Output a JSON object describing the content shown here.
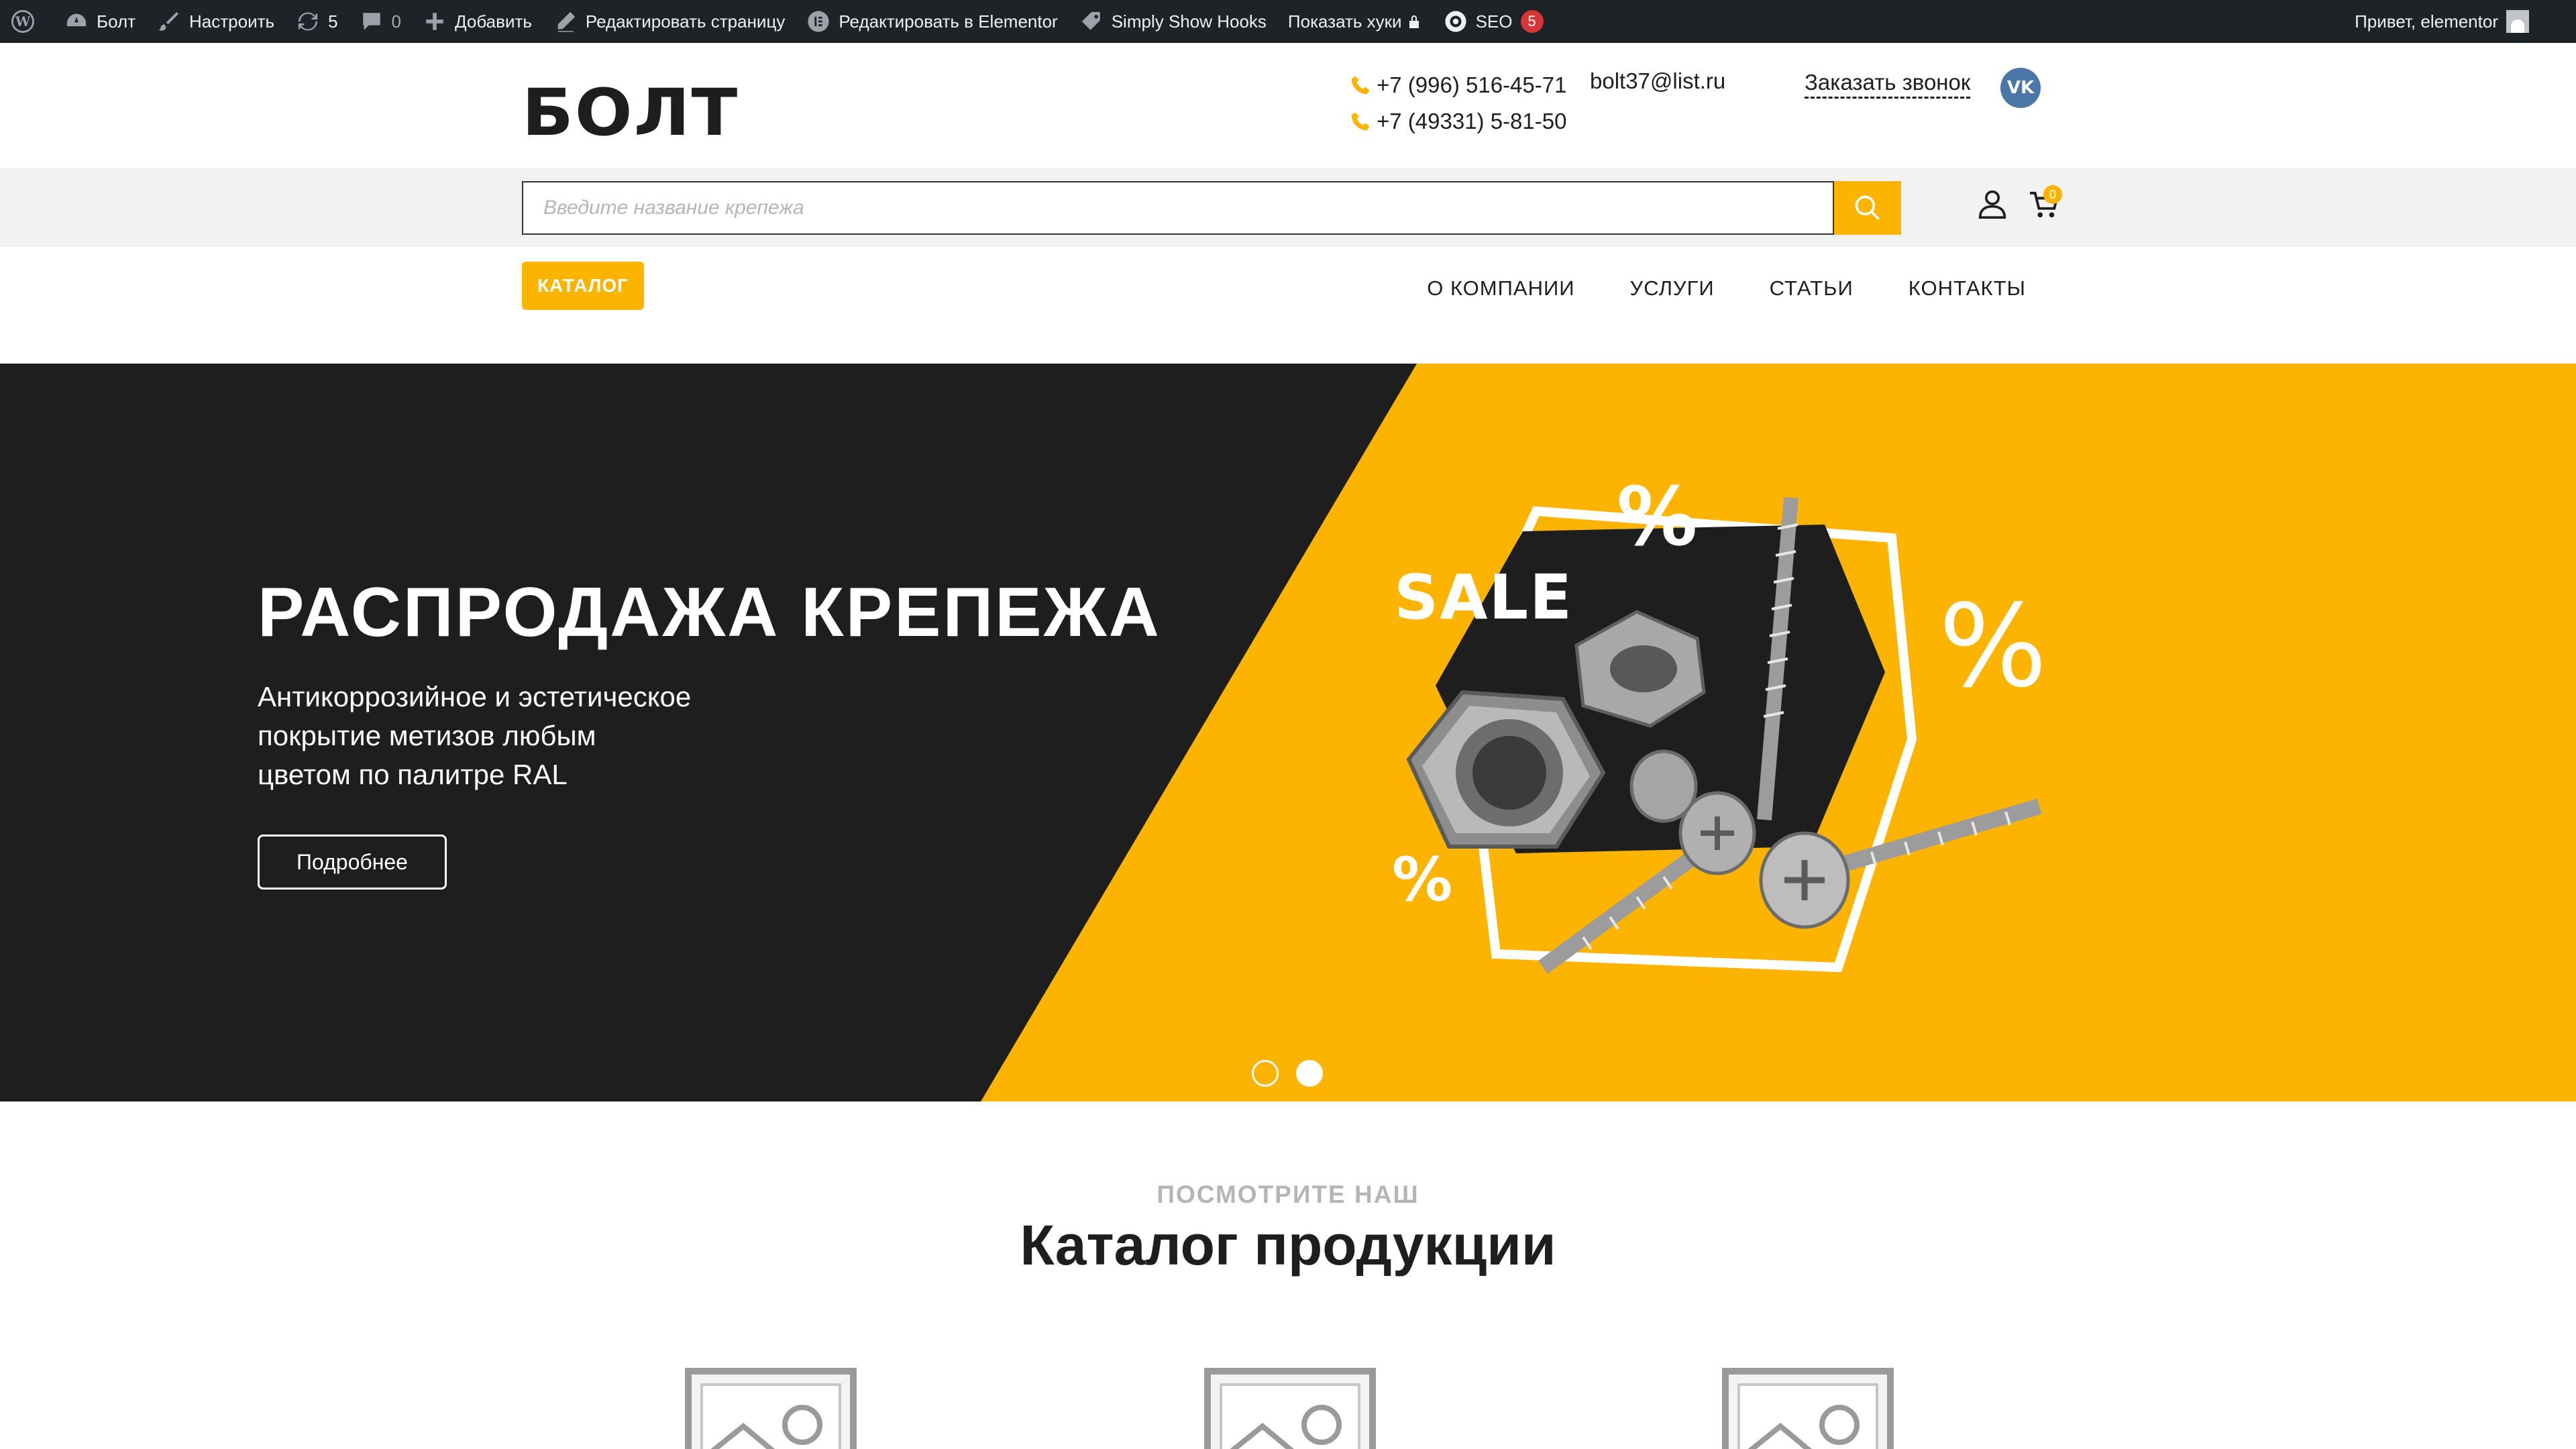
{
  "adminbar": {
    "site_name": "Болт",
    "customize": "Настроить",
    "updates_count": "5",
    "comments_count": "0",
    "add_new": "Добавить",
    "edit_page": "Редактировать страницу",
    "edit_elementor": "Редактировать в Elementor",
    "simply_show_hooks": "Simply Show Hooks",
    "show_hooks": "Показать хуки",
    "seo": "SEO",
    "seo_count": "5",
    "greeting": "Привет, elementor"
  },
  "header": {
    "logo": "БОЛТ",
    "phone1": "+7 (996) 516-45-71",
    "phone2": "+7 (49331) 5-81-50",
    "email": "bolt37@list.ru",
    "callback": "Заказать звонок",
    "vk": "VK"
  },
  "search": {
    "placeholder": "Введите название крепежа",
    "value": "",
    "cart_count": "0"
  },
  "nav": {
    "catalog": "КАТАЛОГ",
    "items": [
      "О КОМПАНИИ",
      "УСЛУГИ",
      "СТАТЬИ",
      "КОНТАКТЫ"
    ]
  },
  "hero": {
    "title": "РАСПРОДАЖА КРЕПЕЖА",
    "subtitle_lines": [
      "Антикоррозийное и эстетическое",
      "покрытие метизов любым",
      "цветом по палитре RAL"
    ],
    "button": "Подробнее",
    "art_sale": "SALE",
    "art_percent": "%",
    "active_slide": 2,
    "slide_count": 2
  },
  "catalog_section": {
    "kicker": "ПОСМОТРИТЕ НАШ",
    "title": "Каталог продукции"
  },
  "colors": {
    "accent": "#fdb400",
    "dark": "#1e1e1e",
    "adminbar": "#1d2327",
    "vk": "#4a76a8"
  }
}
